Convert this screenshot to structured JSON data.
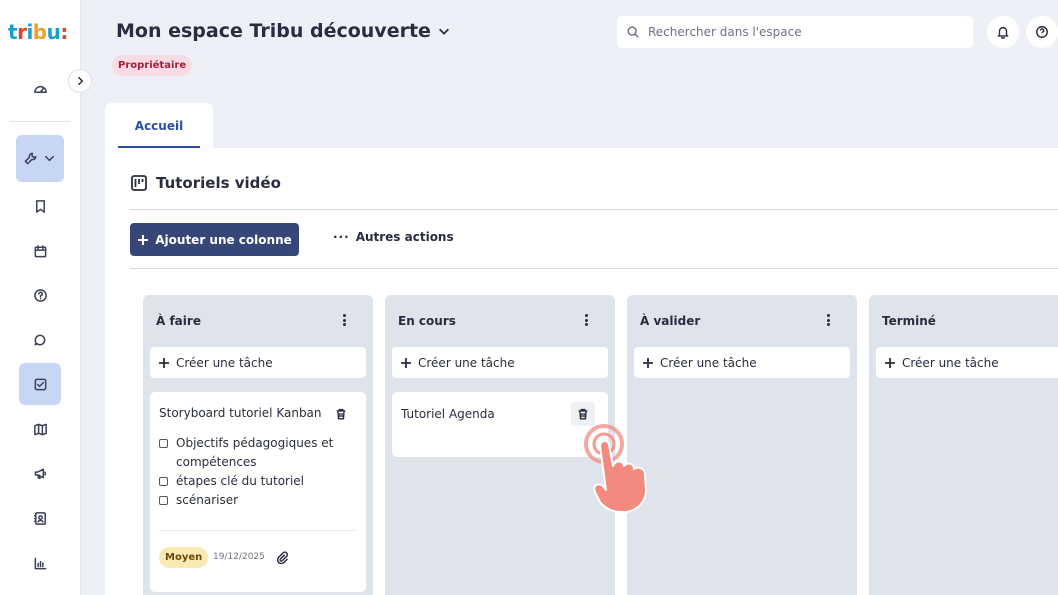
{
  "app": {
    "logo": "tribu:"
  },
  "header": {
    "space_title": "Mon espace Tribu découverte",
    "role_badge": "Propriétaire",
    "search_placeholder": "Rechercher dans l'espace"
  },
  "tabs": [
    {
      "label": "Accueil",
      "active": true
    }
  ],
  "section": {
    "title": "Tutoriels vidéo",
    "add_column_label": "Ajouter une colonne",
    "more_actions_label": "Autres actions"
  },
  "board": {
    "create_task_label": "Créer une tâche",
    "columns": [
      {
        "title": "À faire"
      },
      {
        "title": "En cours"
      },
      {
        "title": "À valider"
      },
      {
        "title": "Terminé"
      }
    ],
    "cards": {
      "todo_card": {
        "title": "Storyboard tutoriel Kanban",
        "checklist": [
          "Objectifs pédagogiques et compétences",
          "étapes clé du tutoriel",
          "scénariser"
        ],
        "priority": "Moyen",
        "due_date": "19/12/2025"
      },
      "inprogress_card": {
        "title": "Tutoriel Agenda"
      }
    }
  },
  "colors": {
    "primary": "#354677",
    "accent_blue": "#2d4fa0",
    "role_badge_bg": "#fadbe3",
    "role_badge_text": "#a3203e",
    "priority_bg": "#fbe9b4",
    "column_bg": "#dfe3ec",
    "cursor": "#f28b7e"
  },
  "icons": {
    "sidebar": [
      "dashboard-icon",
      "wrench-icon",
      "bookmark-icon",
      "calendar-icon",
      "help-icon",
      "chat-icon",
      "tasks-icon",
      "map-icon",
      "megaphone-icon",
      "contacts-icon",
      "stats-icon"
    ],
    "header": [
      "bell-icon",
      "help-icon"
    ]
  }
}
